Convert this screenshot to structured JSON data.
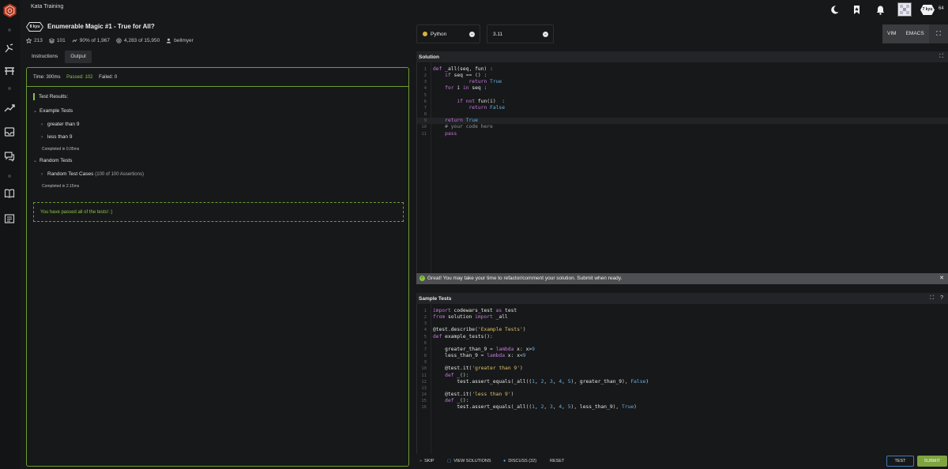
{
  "topbar": {
    "title": "Kata Training",
    "kyu": "7 kyu",
    "honor": "64"
  },
  "kata": {
    "kyu": "8 kyu",
    "title": "Enumerable Magic #1 - True for All?",
    "stats": {
      "stars": "213",
      "collections": "101",
      "satisfaction": "90% of 1,967",
      "completions": "4,283 of 15,950",
      "author": "bellmyer"
    }
  },
  "tabs": [
    "Instructions",
    "Output"
  ],
  "output": {
    "time": "Time: 300ms",
    "passed": "Passed: 102",
    "failed": "Failed: 0",
    "results_title": "Test Results:",
    "example_group": "Example Tests",
    "example_tests": [
      "greater than 9",
      "less than 9"
    ],
    "example_completed": "Completed in 0.05ms",
    "random_group": "Random Tests",
    "random_case": "Random Test Cases",
    "random_assertions": "(100 of 100 Assertions)",
    "random_completed": "Completed in 2.15ms",
    "pass_message": "You have passed all of the tests! :)"
  },
  "selectors": {
    "language": "Python",
    "version": "3.11"
  },
  "keymaps": [
    "VIM",
    "EMACS"
  ],
  "solution": {
    "title": "Solution",
    "lines": [
      "def _all(seq, fun) :",
      "    if seq == () :",
      "            return True",
      "    for i in seq :",
      "",
      "        if not fun(i)  :",
      "            return False",
      "",
      "    return True",
      "    # your code here",
      "    pass"
    ]
  },
  "banner": "Great! You may take your time to refactor/comment your solution. Submit when ready.",
  "sample_tests": {
    "title": "Sample Tests",
    "lines": [
      "import codewars_test as test",
      "from solution import _all",
      "",
      "@test.describe('Example Tests')",
      "def example_tests():",
      "",
      "    greater_than_9 = lambda x: x>9",
      "    less_than_9 = lambda x: x<9",
      "",
      "    @test.it('greater than 9')",
      "    def _():",
      "        test.assert_equals(_all((1, 2, 3, 4, 5), greater_than_9), False)",
      "",
      "    @test.it('less than 9')",
      "    def _():",
      "        test.assert_equals(_all((1, 2, 3, 4, 5), less_than_9), True)"
    ]
  },
  "bottom": {
    "skip": "SKIP",
    "view_solutions": "VIEW SOLUTIONS",
    "discuss": "DISCUSS (32)",
    "reset": "RESET",
    "test": "TEST",
    "submit": "SUBMIT"
  },
  "colors": {
    "accent_green": "#8bc34a",
    "border_green": "#6d9d31",
    "brand_red": "#b1361e",
    "submit_bg": "#7ea43f",
    "test_border": "#3d7ab8"
  }
}
